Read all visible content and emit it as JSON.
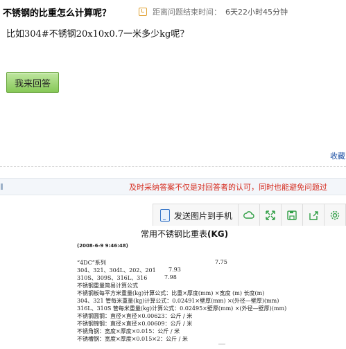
{
  "question": {
    "title": "不锈钢的比重怎么计算呢？",
    "timer_label": "距离问题结束时间：",
    "timer_value": "6天22小时45分钟",
    "body": "比如304#不锈钢20x10x0.7一米多少kg呢？"
  },
  "actions": {
    "answer_button": "我来回答",
    "collect_link": "收藏"
  },
  "notice": {
    "text": "及时采纳答案不仅是对回答者的认可，同时也能避免问题过"
  },
  "toolbar": {
    "send_to_phone": "发送图片到手机",
    "icons": [
      "cloud-icon",
      "expand-icon",
      "save-icon",
      "share-icon",
      "settings-icon"
    ]
  },
  "doc": {
    "title_prefix": "常用不锈钢比重表",
    "title_suffix": "(KG)",
    "date": "(2008-6-9 9:46:48)",
    "rows": [
      {
        "text": "“4DC”系列",
        "value": "7.75"
      },
      {
        "text": "304、321、304L、202、201",
        "value": "7.93"
      },
      {
        "text": "310S、309S、316L、316",
        "value": "7.98"
      },
      {
        "text": "不锈钢重量简易计算公式",
        "value": ""
      },
      {
        "text": "不锈钢板每平方米重量(kg)计算公式：比重×厚度(mm) ×宽度 (m) 长度(m)",
        "value": ""
      },
      {
        "text": "304、321 管每米重量(kg)计算公式：0.02491×壁厚(mm) ×(外径—壁厚)(mm)",
        "value": ""
      },
      {
        "text": "316L、310S 管每米重量(kg)计算公式：0.02495×壁厚(mm) ×(外径—壁厚)(mm)",
        "value": ""
      },
      {
        "text": "不锈钢圆钢：直径×直径×0.00623：公斤 / 米",
        "value": ""
      },
      {
        "text": "不锈钢锦钢：直径×直径×0.00609：公斤 / 米",
        "value": ""
      },
      {
        "text": "不锈角钢：宽度×厚度×0.015：公斤 / 米",
        "value": ""
      },
      {
        "text": "不锈槽钢：宽度×厚度×0.015×2：公斤 / 米",
        "value": ""
      }
    ]
  }
}
